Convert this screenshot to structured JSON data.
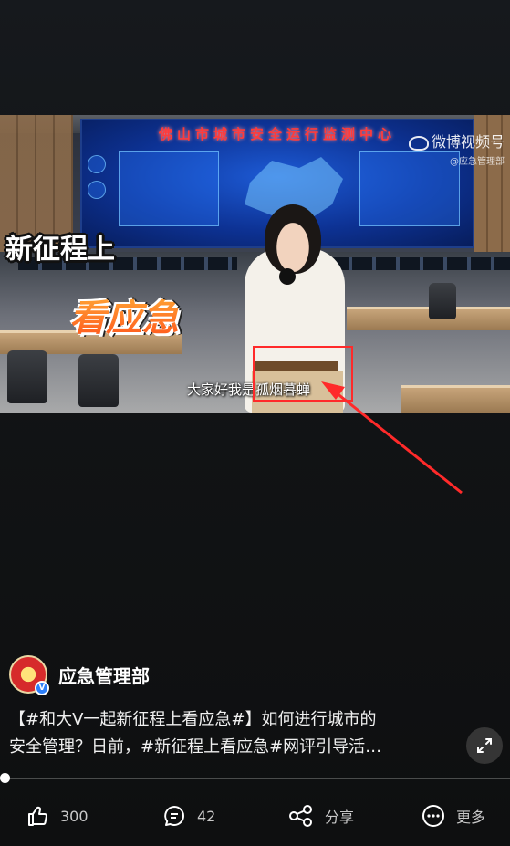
{
  "video": {
    "screen_title": "佛山市城市安全运行监测中心",
    "overlay_line1": "新征程上",
    "overlay_line2": "看应急",
    "watermark_main": "微博视频号",
    "watermark_sub": "@应急管理部",
    "subtitle": "大家好我是孤烟暮蝉"
  },
  "author": {
    "name": "应急管理部",
    "verified_badge": "V"
  },
  "post": {
    "line1": "【#和大V一起新征程上看应急#】如何进行城市的",
    "line2": "安全管理？日前，#新征程上看应急#网评引导活…"
  },
  "progress": {
    "fraction": 0.0
  },
  "actions": {
    "like_count": "300",
    "comment_count": "42",
    "share_label": "分享",
    "more_label": "更多"
  },
  "colors": {
    "highlight": "#ff2a2a",
    "background": "#121416"
  },
  "icons": [
    "thumbs-up-icon",
    "comment-icon",
    "share-icon",
    "more-icon",
    "expand-icon"
  ]
}
